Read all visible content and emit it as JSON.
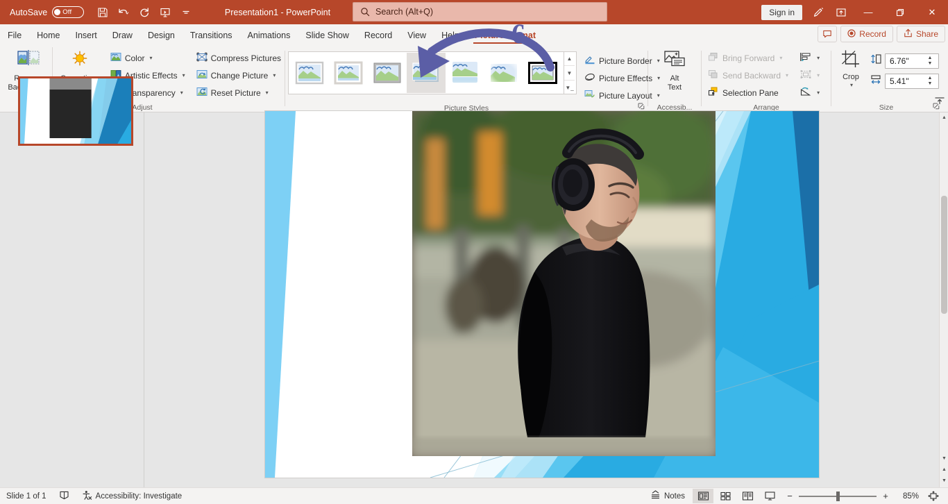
{
  "titlebar": {
    "autosave_label": "AutoSave",
    "autosave_state": "Off",
    "document_title": "Presentation1  -  PowerPoint",
    "signin_label": "Sign in",
    "quick_access": [
      {
        "name": "save-icon",
        "tooltip": "Save"
      },
      {
        "name": "undo-icon",
        "tooltip": "Undo"
      },
      {
        "name": "redo-icon",
        "tooltip": "Redo"
      },
      {
        "name": "start-from-beginning-icon",
        "tooltip": "Start From Beginning"
      },
      {
        "name": "customize-quick-access-toolbar-icon",
        "tooltip": "Customize Quick Access Toolbar"
      }
    ],
    "window_controls": {
      "minimize": "—",
      "restore": "❐",
      "close": "✕"
    },
    "accent_color": "#b7472a"
  },
  "search": {
    "placeholder": "Search (Alt+Q)",
    "value": ""
  },
  "tabs": [
    {
      "label": "File",
      "active": false
    },
    {
      "label": "Home",
      "active": false
    },
    {
      "label": "Insert",
      "active": false
    },
    {
      "label": "Draw",
      "active": false
    },
    {
      "label": "Design",
      "active": false
    },
    {
      "label": "Transitions",
      "active": false
    },
    {
      "label": "Animations",
      "active": false
    },
    {
      "label": "Slide Show",
      "active": false
    },
    {
      "label": "Record",
      "active": false
    },
    {
      "label": "View",
      "active": false
    },
    {
      "label": "Help",
      "active": false
    },
    {
      "label": "Picture Format",
      "active": true
    }
  ],
  "tabbar_right": {
    "comments_tooltip": "Comments",
    "record_label": "Record",
    "share_label": "Share"
  },
  "ribbon": {
    "groups": [
      {
        "name": "Adjust",
        "big_buttons": [
          {
            "label_line1": "Remove",
            "label_line2": "Background",
            "icon": "remove-background-icon"
          },
          {
            "label_line1": "Corrections",
            "label_line2": "",
            "icon": "corrections-icon",
            "has_caret": true
          }
        ],
        "small_buttons": [
          {
            "label": "Color",
            "icon": "color-icon",
            "caret": true,
            "disabled": false
          },
          {
            "label": "Artistic Effects",
            "icon": "artistic-effects-icon",
            "caret": true,
            "disabled": false
          },
          {
            "label": "Transparency",
            "icon": "transparency-icon",
            "caret": true,
            "disabled": false
          },
          {
            "label": "Compress Pictures",
            "icon": "compress-pictures-icon",
            "caret": false,
            "disabled": false
          },
          {
            "label": "Change Picture",
            "icon": "change-picture-icon",
            "caret": true,
            "disabled": false
          },
          {
            "label": "Reset Picture",
            "icon": "reset-picture-icon",
            "caret": true,
            "disabled": false
          }
        ]
      },
      {
        "name": "Picture Styles",
        "gallery": {
          "selected_index": 3,
          "items": [
            {
              "name": "style-simple-frame-white",
              "frame": "thin-gray"
            },
            {
              "name": "style-beveled-matte-white",
              "frame": "matte"
            },
            {
              "name": "style-metal-frame",
              "frame": "metal"
            },
            {
              "name": "style-drop-shadow-rectangle",
              "frame": "shadow"
            },
            {
              "name": "style-reflected-rounded-rectangle",
              "frame": "reflected"
            },
            {
              "name": "style-soft-edge-rectangle",
              "frame": "soft-edge"
            },
            {
              "name": "style-double-frame-black",
              "frame": "double-black"
            }
          ],
          "scroll_up": "▲",
          "scroll_down": "▼",
          "more": "☰"
        },
        "small_buttons": [
          {
            "label": "Picture Border",
            "icon": "picture-border-icon",
            "caret": true
          },
          {
            "label": "Picture Effects",
            "icon": "picture-effects-icon",
            "caret": true
          },
          {
            "label": "Picture Layout",
            "icon": "picture-layout-icon",
            "caret": true
          }
        ],
        "dialog_launcher": true
      },
      {
        "name": "Accessib...",
        "big_buttons": [
          {
            "label_line1": "Alt",
            "label_line2": "Text",
            "icon": "alt-text-icon"
          }
        ]
      },
      {
        "name": "Arrange",
        "small_buttons": [
          {
            "label": "Bring Forward",
            "icon": "bring-forward-icon",
            "caret": true,
            "disabled": true
          },
          {
            "label": "Send Backward",
            "icon": "send-backward-icon",
            "caret": true,
            "disabled": true
          },
          {
            "label": "Selection Pane",
            "icon": "selection-pane-icon",
            "caret": false,
            "disabled": false
          }
        ],
        "icon_buttons": [
          {
            "name": "align-icon",
            "caret": true,
            "disabled": false
          },
          {
            "name": "group-icon",
            "caret": true,
            "disabled": true
          },
          {
            "name": "rotate-icon",
            "caret": true,
            "disabled": false
          }
        ]
      },
      {
        "name": "Size",
        "big_buttons": [
          {
            "label_line1": "Crop",
            "label_line2": "",
            "icon": "crop-icon",
            "has_caret": true
          }
        ],
        "fields": [
          {
            "name": "shape-height",
            "icon": "height-icon",
            "value": "6.76\""
          },
          {
            "name": "shape-width",
            "icon": "width-icon",
            "value": "5.41\""
          }
        ],
        "dialog_launcher": true
      }
    ],
    "collapse_ribbon_icon": "collapse-ribbon-icon"
  },
  "thumbnail_pane": {
    "slides": [
      {
        "index": 1,
        "selected": true
      }
    ]
  },
  "slide": {
    "layout_name": "Facet / Blue geometric",
    "picture": {
      "name": "man-with-headphones-photo",
      "selected": true
    }
  },
  "annotation": {
    "step_number": "6",
    "arrow_color": "#5b5ea6",
    "points_to": "style-drop-shadow-rectangle"
  },
  "statusbar": {
    "slide_counter": "Slide 1 of 1",
    "spellcheck_icon": "spellcheck-icon",
    "accessibility_label": "Accessibility: Investigate",
    "notes_label": "Notes",
    "views": [
      {
        "name": "normal-view",
        "active": true
      },
      {
        "name": "slide-sorter-view",
        "active": false
      },
      {
        "name": "reading-view",
        "active": false
      },
      {
        "name": "slide-show-view",
        "active": false
      }
    ],
    "zoom_out": "−",
    "zoom_in": "+",
    "zoom_level": "85%",
    "fit_slide_icon": "fit-slide-to-window-icon"
  }
}
